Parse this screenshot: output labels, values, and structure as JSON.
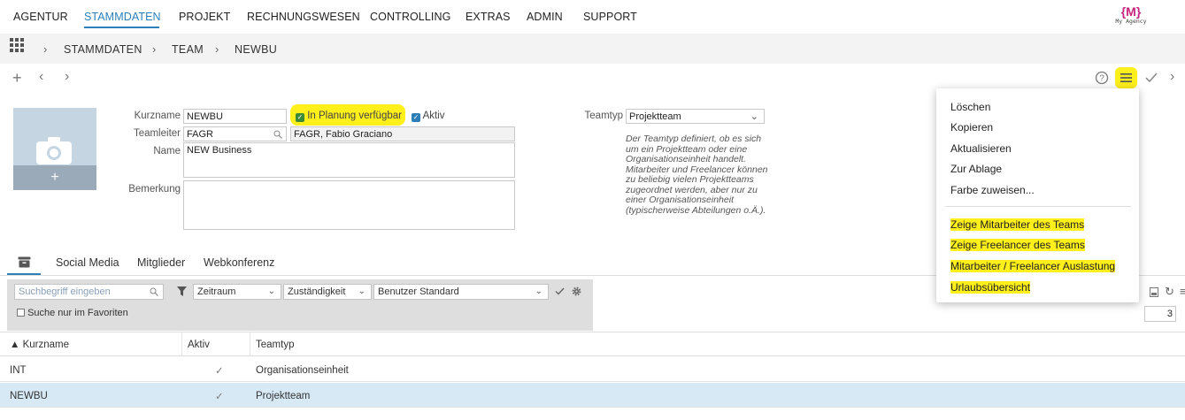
{
  "nav": {
    "items": [
      "AGENTUR",
      "STAMMDATEN",
      "PROJEKT",
      "RECHNUNGSWESEN",
      "CONTROLLING",
      "EXTRAS",
      "ADMIN",
      "SUPPORT"
    ],
    "active": "STAMMDATEN",
    "logo_mark": "{M}",
    "logo_text": "My Agency"
  },
  "breadcrumb": [
    "STAMMDATEN",
    "TEAM",
    "NEWBU"
  ],
  "form": {
    "kurzname_label": "Kurzname",
    "kurzname_value": "NEWBU",
    "in_planung_label": "In Planung verfügbar",
    "aktiv_label": "Aktiv",
    "teamleiter_label": "Teamleiter",
    "teamleiter_value": "FAGR",
    "teamleiter_name": "FAGR, Fabio Graciano",
    "name_label": "Name",
    "name_value": "NEW Business",
    "bemerkung_label": "Bemerkung",
    "bemerkung_value": "",
    "teamtyp_label": "Teamtyp",
    "teamtyp_value": "Projektteam",
    "teamtyp_description": "Der Teamtyp definiert, ob es sich um ein Projektteam oder eine Organisationseinheit handelt. Mitarbeiter und Freelancer können zu beliebig vielen Projektteams zugeordnet werden, aber nur zu einer Organisationseinheit (typischerweise Abteilungen o.Ä.)."
  },
  "tabs": [
    "Social Media",
    "Mitglieder",
    "Webkonferenz"
  ],
  "filter": {
    "search_placeholder": "Suchbegriff eingeben",
    "favorites_label": "Suche nur im Favoriten",
    "zeitraum": "Zeitraum",
    "zustaendigkeit": "Zuständigkeit",
    "benutzer": "Benutzer Standard",
    "page_count": "3"
  },
  "table": {
    "headers": [
      "▲ Kurzname",
      "Aktiv",
      "Teamtyp"
    ],
    "rows": [
      {
        "kurzname": "INT",
        "aktiv": "✓",
        "teamtyp": "Organisationseinheit"
      },
      {
        "kurzname": "NEWBU",
        "aktiv": "✓",
        "teamtyp": "Projektteam"
      }
    ]
  },
  "menu": {
    "items": [
      "Löschen",
      "Kopieren",
      "Aktualisieren",
      "Zur Ablage",
      "Farbe zuweisen..."
    ],
    "team_items": [
      "Zeige Mitarbeiter des Teams",
      "Zeige Freelancer des Teams",
      "Mitarbeiter / Freelancer Auslastung",
      "Urlaubsübersicht"
    ]
  },
  "colors": {
    "accent": "#2e7fb8",
    "highlight": "#ffef1a",
    "selected_row": "#d8e9f6",
    "logo": "#c8247d"
  }
}
